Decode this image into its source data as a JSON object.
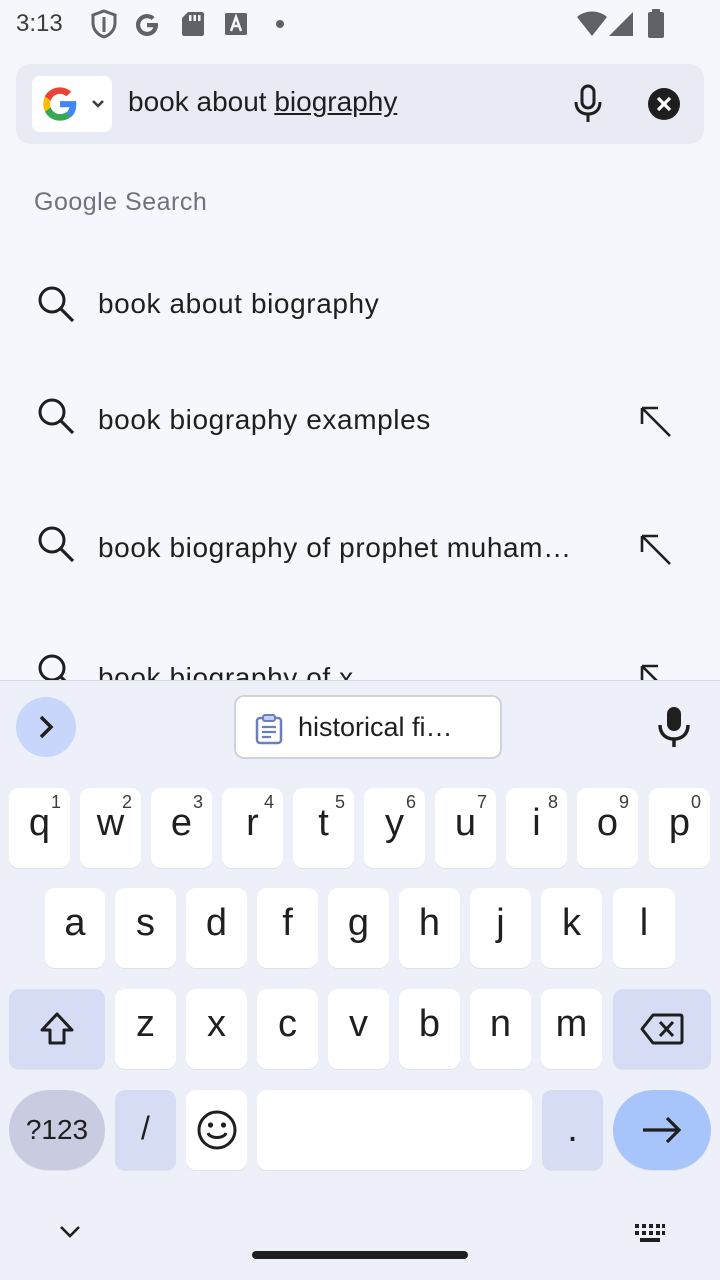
{
  "status_bar": {
    "time": "3:13",
    "left_icons": [
      "shield-icon",
      "google-g-icon",
      "sd-card-icon",
      "text-a-icon",
      "dot-icon"
    ],
    "right_icons": [
      "wifi-icon",
      "cell-signal-icon",
      "battery-icon"
    ]
  },
  "search_bar": {
    "query_plain": "book about ",
    "query_underlined": "biography",
    "logo_icon": "google-logo-icon",
    "voice_icon": "mic-icon",
    "clear_icon": "clear-icon"
  },
  "suggestions_section": {
    "label": "Google Search",
    "items": [
      {
        "text": "book about biography",
        "icon": "search-icon",
        "has_fill_arrow": false
      },
      {
        "text": "book biography examples",
        "icon": "search-icon",
        "has_fill_arrow": true
      },
      {
        "text": "book biography of prophet muhammad",
        "icon": "search-icon",
        "has_fill_arrow": true
      },
      {
        "text": "book biography of x",
        "icon": "search-icon",
        "has_fill_arrow": true
      }
    ]
  },
  "keyboard": {
    "clipboard_suggestion": "historical fi…",
    "row1": [
      {
        "label": "q",
        "hint": "1"
      },
      {
        "label": "w",
        "hint": "2"
      },
      {
        "label": "e",
        "hint": "3"
      },
      {
        "label": "r",
        "hint": "4"
      },
      {
        "label": "t",
        "hint": "5"
      },
      {
        "label": "y",
        "hint": "6"
      },
      {
        "label": "u",
        "hint": "7"
      },
      {
        "label": "i",
        "hint": "8"
      },
      {
        "label": "o",
        "hint": "9"
      },
      {
        "label": "p",
        "hint": "0"
      }
    ],
    "row2": [
      "a",
      "s",
      "d",
      "f",
      "g",
      "h",
      "j",
      "k",
      "l"
    ],
    "row3": [
      "z",
      "x",
      "c",
      "v",
      "b",
      "n",
      "m"
    ],
    "symbols_label": "?123",
    "slash_label": "/",
    "period_label": "."
  },
  "colors": {
    "accent": "#a8c5fb",
    "modifier_key": "#d5dcf3",
    "background": "#f6f7fc"
  }
}
